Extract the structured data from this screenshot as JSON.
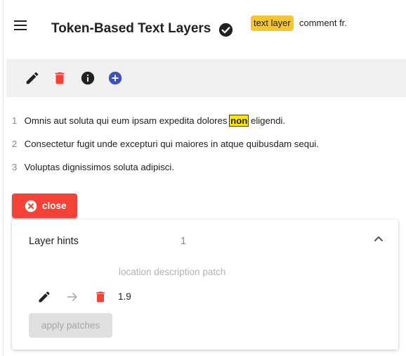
{
  "header": {
    "title": "Token-Based Text Layers",
    "chip_label": "text layer",
    "subtitle": "comment fr."
  },
  "toolbar": {
    "icons": [
      "edit-icon",
      "delete-icon",
      "info-icon",
      "add-icon"
    ]
  },
  "text_lines": [
    {
      "num": "1",
      "before": "Omnis aut soluta qui eum ipsam expedita dolores ",
      "highlight": "non",
      "after": " eligendi."
    },
    {
      "num": "2",
      "before": "Consectetur fugit unde excepturi qui maiores in atque quibusdam sequi.",
      "highlight": "",
      "after": ""
    },
    {
      "num": "3",
      "before": "Voluptas dignissimos soluta adipisci.",
      "highlight": "",
      "after": ""
    }
  ],
  "close_button": {
    "label": "close"
  },
  "panel": {
    "title": "Layer hints",
    "count": "1",
    "column_headers": "location description patch",
    "rows": [
      {
        "value": "1.9"
      }
    ],
    "apply_label": "apply patches"
  },
  "colors": {
    "accent_red": "#f44336",
    "chip_yellow": "#f7c52e",
    "highlight_yellow": "#ffe600",
    "add_blue": "#3f51b5"
  }
}
